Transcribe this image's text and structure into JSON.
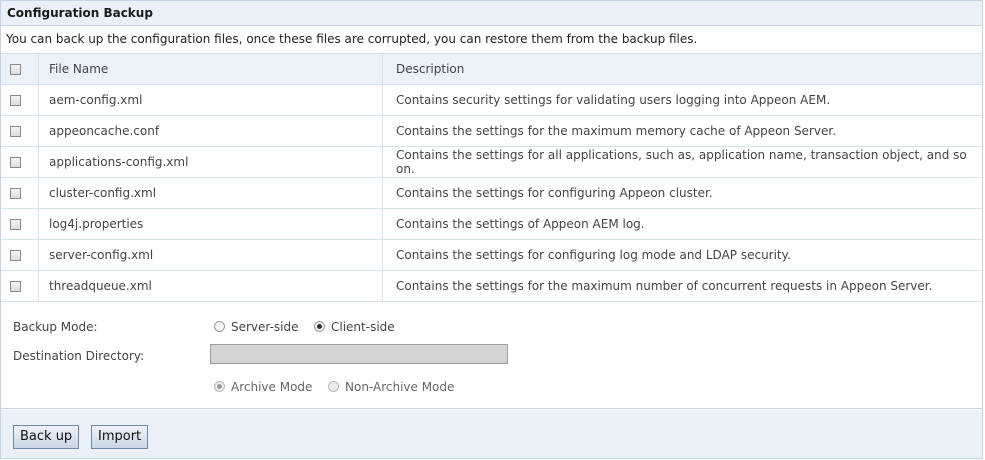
{
  "panel": {
    "title": "Configuration Backup",
    "intro": "You can back up the configuration files, once these files are corrupted, you can restore them from the backup files."
  },
  "table": {
    "headers": {
      "file_name": "File Name",
      "description": "Description"
    },
    "rows": [
      {
        "file": "aem-config.xml",
        "desc": "Contains security settings for validating users logging into Appeon AEM."
      },
      {
        "file": "appeoncache.conf",
        "desc": "Contains the settings for the maximum memory cache of Appeon Server."
      },
      {
        "file": "applications-config.xml",
        "desc": "Contains the settings for all applications, such as, application name, transaction object, and so on."
      },
      {
        "file": "cluster-config.xml",
        "desc": "Contains the settings for configuring Appeon cluster."
      },
      {
        "file": "log4j.properties",
        "desc": "Contains the settings of Appeon AEM log."
      },
      {
        "file": "server-config.xml",
        "desc": "Contains the settings for configuring log mode and LDAP security."
      },
      {
        "file": "threadqueue.xml",
        "desc": "Contains the settings for the maximum number of concurrent requests in Appeon Server."
      }
    ]
  },
  "options": {
    "backup_mode_label": "Backup Mode:",
    "server_side": "Server-side",
    "client_side": "Client-side",
    "selected_mode": "client_side",
    "destination_label": "Destination Directory:",
    "destination_value": "",
    "archive_mode": "Archive Mode",
    "non_archive_mode": "Non-Archive Mode",
    "selected_archive": "archive_mode"
  },
  "buttons": {
    "backup": "Back up",
    "import": "Import"
  }
}
